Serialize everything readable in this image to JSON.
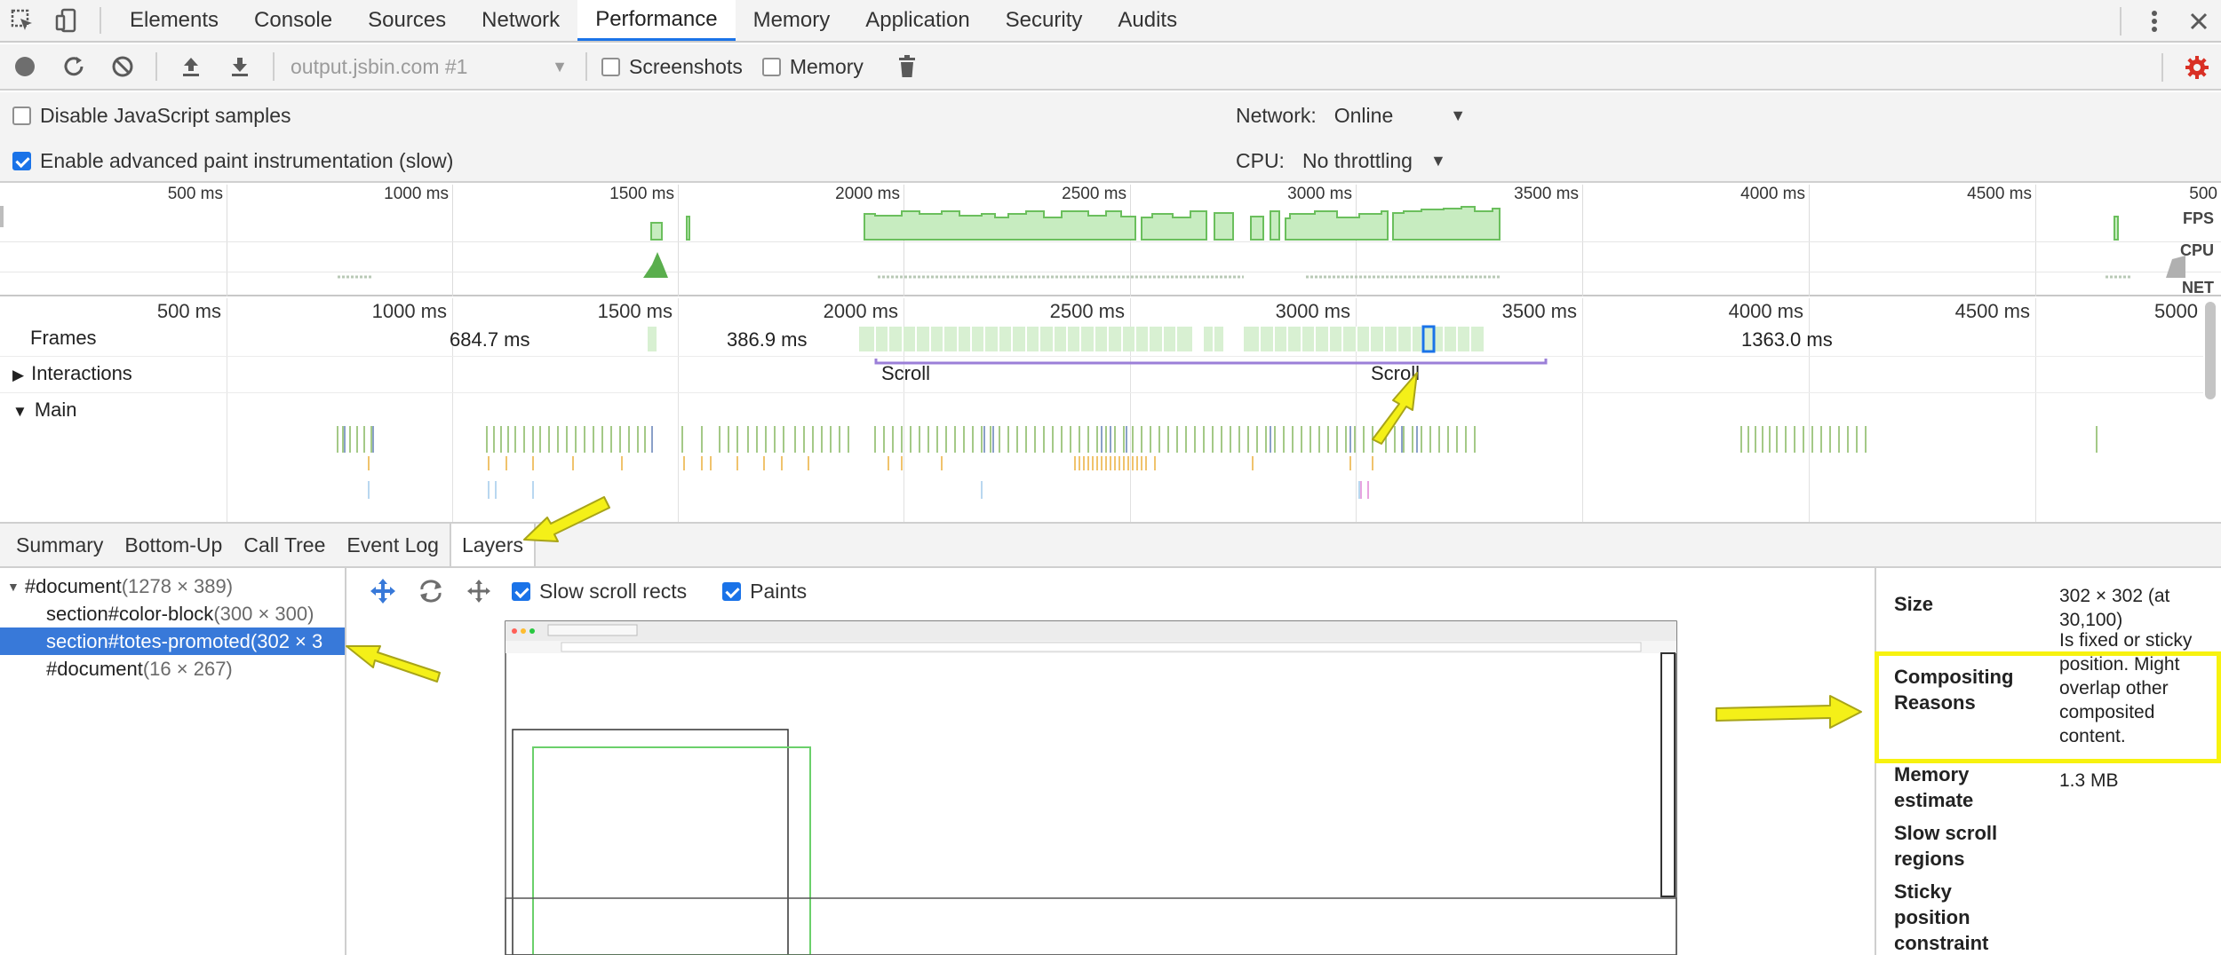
{
  "tabs": [
    "Elements",
    "Console",
    "Sources",
    "Network",
    "Performance",
    "Memory",
    "Application",
    "Security",
    "Audits"
  ],
  "active_tab": "Performance",
  "toolbar": {
    "recording": "output.jsbin.com #1",
    "screenshots_label": "Screenshots",
    "memory_label": "Memory"
  },
  "settings": {
    "disable_js_label": "Disable JavaScript samples",
    "advanced_paint_label": "Enable advanced paint instrumentation (slow)",
    "network_label": "Network:",
    "network_value": "Online",
    "cpu_label": "CPU:",
    "cpu_value": "No throttling"
  },
  "overview": {
    "ticks": [
      "500 ms",
      "1000 ms",
      "1500 ms",
      "2000 ms",
      "2500 ms",
      "3000 ms",
      "3500 ms",
      "4000 ms",
      "4500 ms",
      "500"
    ],
    "lanes": [
      "FPS",
      "CPU",
      "NET"
    ]
  },
  "timeline": {
    "ticks": [
      "500 ms",
      "1000 ms",
      "1500 ms",
      "2000 ms",
      "2500 ms",
      "3000 ms",
      "3500 ms",
      "4000 ms",
      "4500 ms",
      "5000"
    ],
    "tracks": {
      "frames": "Frames",
      "interactions": "Interactions",
      "main": "Main"
    },
    "frame_durations": [
      "684.7 ms",
      "386.9 ms",
      "1363.0 ms"
    ],
    "interactions": [
      "Scroll",
      "Scroll"
    ]
  },
  "bottom_tabs": [
    "Summary",
    "Bottom-Up",
    "Call Tree",
    "Event Log",
    "Layers"
  ],
  "active_bottom_tab": "Layers",
  "layer_tree": [
    {
      "name": "#document",
      "size": "(1278 × 389)",
      "indent": 0,
      "expanded": true,
      "selected": false
    },
    {
      "name": "section#color-block",
      "size": "(300 × 300)",
      "indent": 1,
      "selected": false
    },
    {
      "name": "section#totes-promoted",
      "size": "(302 × 3",
      "indent": 1,
      "selected": true
    },
    {
      "name": "#document",
      "size": "(16 × 267)",
      "indent": 1,
      "selected": false
    }
  ],
  "layers_toolbar": {
    "slow_scroll_label": "Slow scroll rects",
    "paints_label": "Paints"
  },
  "details": [
    {
      "key": "Size",
      "value": "302 × 302 (at 30,100)"
    },
    {
      "key": "Compositing Reasons",
      "value": "Is fixed or sticky position. Might overlap other composited content."
    },
    {
      "key": "Memory estimate",
      "value": "1.3 MB"
    },
    {
      "key": "Slow scroll regions",
      "value": ""
    },
    {
      "key": "Sticky position constraint",
      "value": ""
    }
  ],
  "colors": {
    "accent": "#1a73e8",
    "selection": "#3879d9",
    "fps_fill": "#c7ecc0",
    "fps_stroke": "#6bbf5d",
    "highlight": "#f7f20f",
    "interaction": "#9b7fd8",
    "settings_gear": "#d93025"
  }
}
